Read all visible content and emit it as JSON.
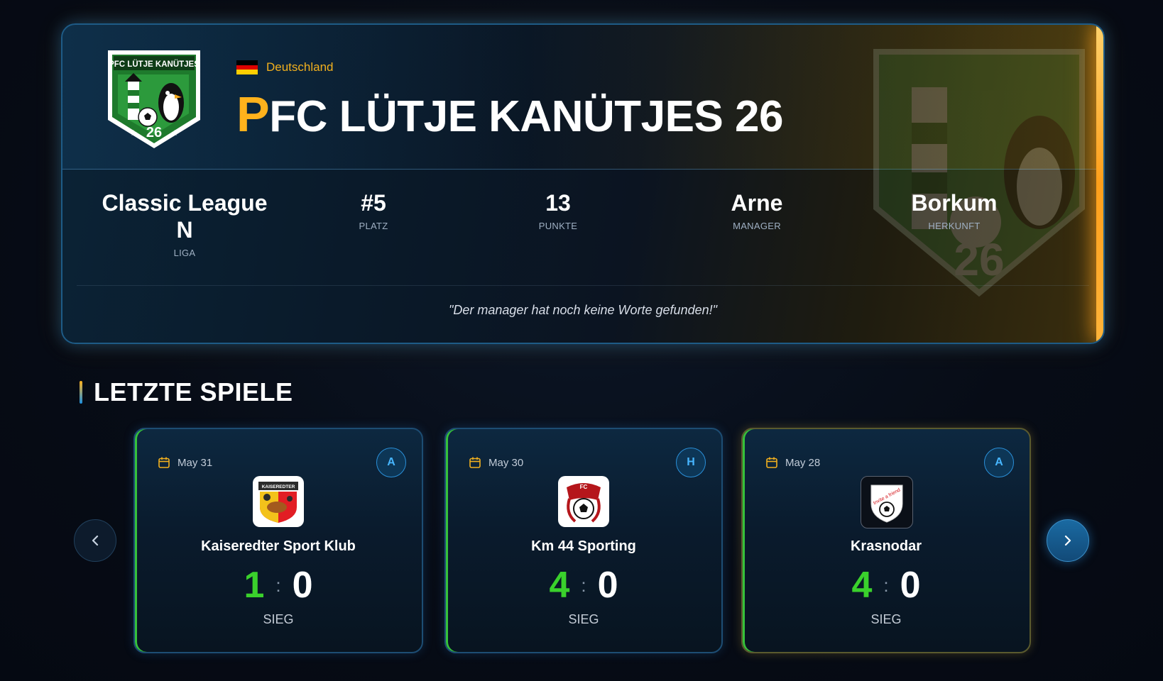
{
  "team": {
    "country": "Deutschland",
    "name_first_letter": "P",
    "name_rest": "FC LÜTJE KANÜTJES 26",
    "crest_text": "PFC LÜTJE KANÜTJES",
    "crest_number": "26"
  },
  "stats": [
    {
      "value": "Classic League N",
      "label": "LIGA"
    },
    {
      "value": "#5",
      "label": "PLATZ"
    },
    {
      "value": "13",
      "label": "PUNKTE"
    },
    {
      "value": "Arne",
      "label": "MANAGER"
    },
    {
      "value": "Borkum",
      "label": "HERKUNFT"
    }
  ],
  "quote": "\"Der manager hat noch keine Worte gefunden!\"",
  "section": {
    "title": "LETZTE SPIELE"
  },
  "matches": [
    {
      "date": "May 31",
      "venue": "A",
      "opponent": "Kaiseredter Sport Klub",
      "score_own": "1",
      "score_sep": ":",
      "score_opp": "0",
      "result": "SIEG"
    },
    {
      "date": "May 30",
      "venue": "H",
      "opponent": "Km 44 Sporting",
      "score_own": "4",
      "score_sep": ":",
      "score_opp": "0",
      "result": "SIEG"
    },
    {
      "date": "May 28",
      "venue": "A",
      "opponent": "Krasnodar",
      "score_own": "4",
      "score_sep": ":",
      "score_opp": "0",
      "result": "SIEG"
    }
  ],
  "logos": {
    "kaiseredter_text": "KAISEREDTER",
    "km44_text": "FC",
    "krasnodar_text": "Invite a friend"
  },
  "icons": {
    "prev": "chevron-left-icon",
    "next": "chevron-right-icon",
    "date": "calendar-icon"
  },
  "colors": {
    "accent_gold": "#ffb21c",
    "accent_blue": "#1b8fe0",
    "win_green": "#3ad12c",
    "flag_black": "#000000",
    "flag_red": "#dd0000",
    "flag_gold": "#ffce00"
  }
}
